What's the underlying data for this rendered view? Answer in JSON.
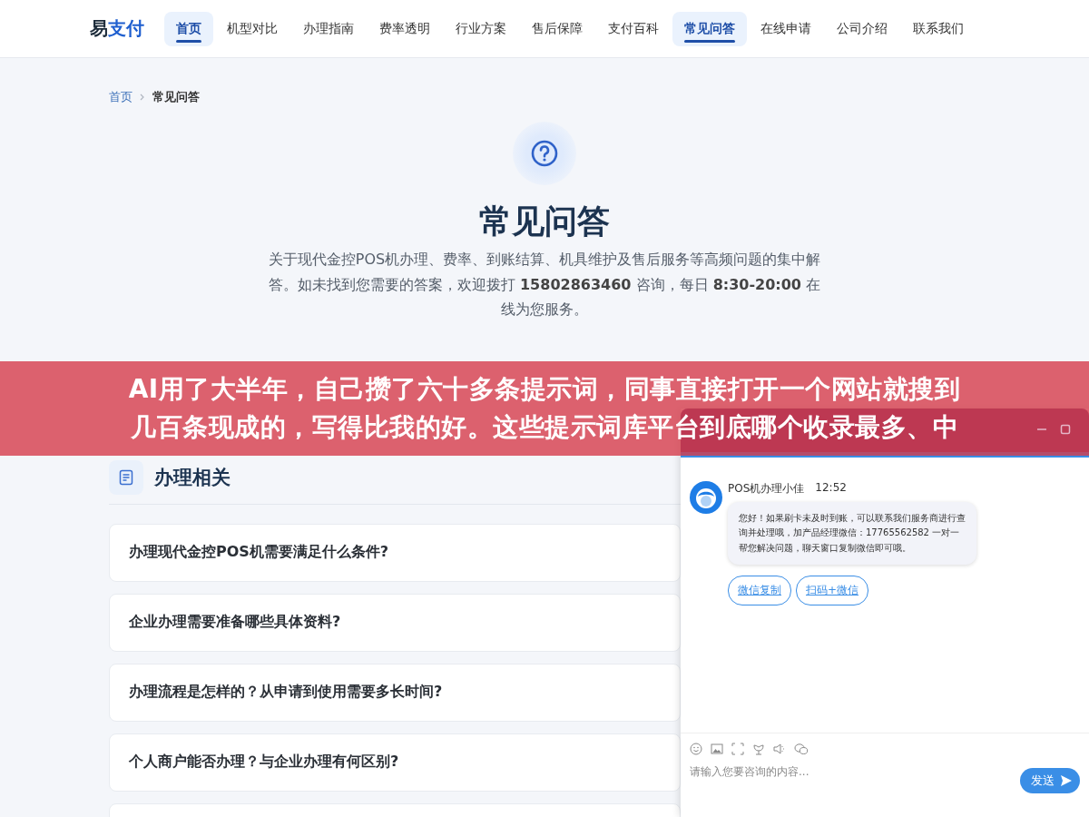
{
  "nav": {
    "logo_prefix": "易",
    "logo_accent": "支付",
    "items": [
      {
        "label": "首页",
        "selected": true
      },
      {
        "label": "机型对比",
        "selected": false
      },
      {
        "label": "办理指南",
        "selected": false
      },
      {
        "label": "费率透明",
        "selected": false
      },
      {
        "label": "行业方案",
        "selected": false
      },
      {
        "label": "售后保障",
        "selected": false
      },
      {
        "label": "支付百科",
        "selected": false
      },
      {
        "label": "常见问答",
        "selected": true
      },
      {
        "label": "在线申请",
        "selected": false
      },
      {
        "label": "公司介绍",
        "selected": false
      },
      {
        "label": "联系我们",
        "selected": false
      }
    ]
  },
  "breadcrumb": [
    {
      "label": "首页",
      "kind": "link"
    },
    {
      "label": "常见问答",
      "kind": "current"
    }
  ],
  "hero": {
    "title": "常见问答",
    "description": "关于现代金控POS机办理、费率、到账结算、机具维护及售后服务等高频问题的集中解答。如未找到您需要的答案，欢迎拨打 **15802863460** 咨询，每日 **8:30-20:00** 在线为您服务。"
  },
  "caption_banner": {
    "lines": [
      "AI用了大半年，自己攒了六十多条提示词，同事直接打开一个网站就搜到",
      "几百条现成的，写得比我的好。这些提示词库平台到底哪个收录最多、中"
    ]
  },
  "section": {
    "title": "办理相关",
    "questions": [
      {
        "text": "办理现代金控POS机需要满足什么条件?"
      },
      {
        "text": "企业办理需要准备哪些具体资料?"
      },
      {
        "text": "办理流程是怎样的？从申请到使用需要多长时间?"
      },
      {
        "text": "个人商户能否办理？与企业办理有何区别?"
      }
    ]
  },
  "chat": {
    "agent": "POS机办理小佳",
    "time": "12:52",
    "message": "您好！如果刷卡未及时到账，可以联系我们服务商进行查询并处理哦，加产品经理微信：17765562582 一对一帮您解决问题，聊天窗口复制微信即可哦。",
    "actions": [
      "微信复制",
      "扫码+微信"
    ],
    "placeholder": "请输入您要咨询的内容...",
    "send": "发送"
  }
}
